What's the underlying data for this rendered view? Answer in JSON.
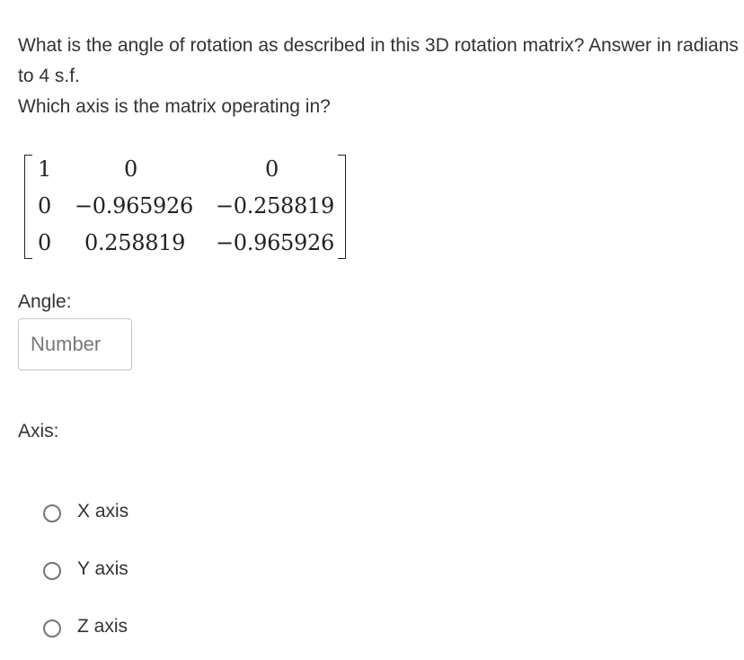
{
  "question": {
    "line1": "What is the angle of rotation as described in this 3D rotation matrix? Answer in radians to 4 s.f.",
    "line2": "Which axis is the matrix operating in?"
  },
  "matrix": {
    "rows": [
      [
        "1",
        "0",
        "0"
      ],
      [
        "0",
        "−0.965926",
        "−0.258819"
      ],
      [
        "0",
        "0.258819",
        "−0.965926"
      ]
    ]
  },
  "angle": {
    "label": "Angle:",
    "placeholder": "Number",
    "value": ""
  },
  "axis": {
    "label": "Axis:",
    "options": [
      {
        "label": "X axis",
        "selected": false
      },
      {
        "label": "Y axis",
        "selected": false
      },
      {
        "label": "Z axis",
        "selected": false
      }
    ]
  }
}
